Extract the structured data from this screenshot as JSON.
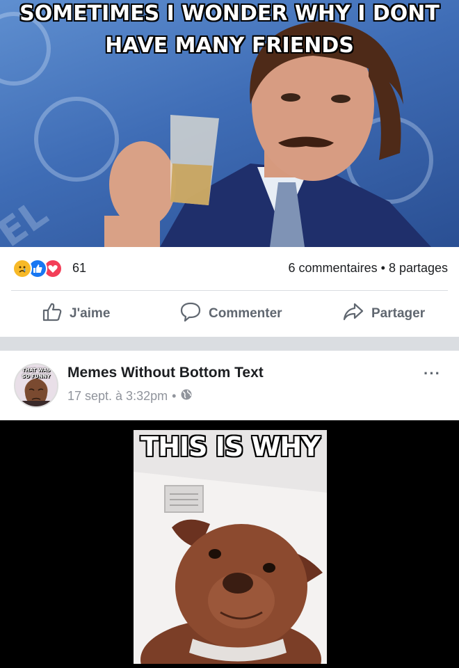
{
  "top_meme": {
    "caption_line1": "SOMETIMES I WONDER WHY I DONT",
    "caption_line2": "HAVE MANY FRIENDS"
  },
  "reactions": {
    "icons": [
      "sad-reaction-icon",
      "like-reaction-icon",
      "love-reaction-icon"
    ],
    "count": "61",
    "comments": "6 commentaires",
    "shares": "8 partages",
    "separator": "•"
  },
  "actions": {
    "like": "J'aime",
    "comment": "Commenter",
    "share": "Partager"
  },
  "post": {
    "page_name": "Memes Without Bottom Text",
    "timestamp": "17 sept. à 3:32pm",
    "separator": "•",
    "avatar_text": "THAT WAS SO FUNNY",
    "more_label": "···"
  },
  "bottom_meme": {
    "caption": "THIS IS WHY"
  },
  "colors": {
    "facebook_blue": "#1877f2",
    "love_red": "#f33e58",
    "sad_yellow": "#f7b928",
    "muted_text": "#606770",
    "divider": "#dadde1"
  }
}
